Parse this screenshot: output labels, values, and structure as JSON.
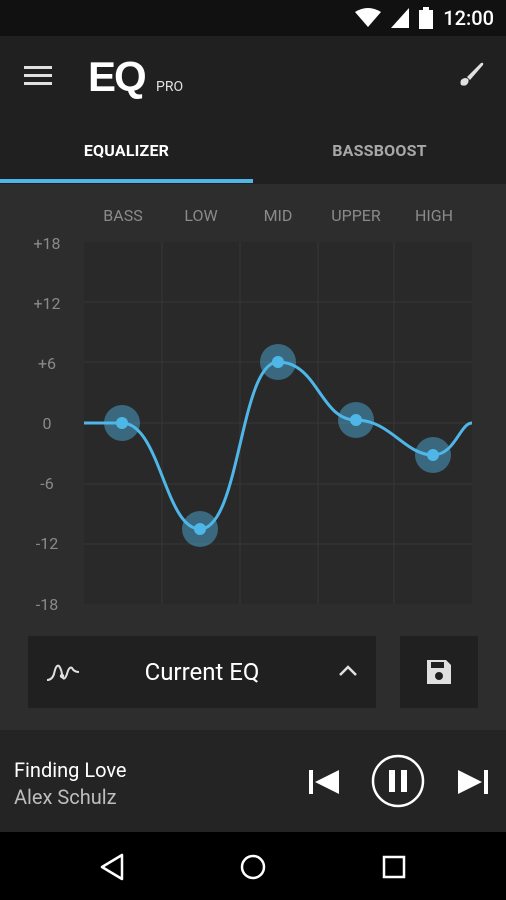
{
  "status": {
    "time": "12:00"
  },
  "app": {
    "logo": "EQ",
    "logo_sub": "PRO"
  },
  "tabs": [
    {
      "label": "EQUALIZER",
      "active": true
    },
    {
      "label": "BASSBOOST",
      "active": false
    }
  ],
  "bands": [
    "BASS",
    "LOW",
    "MID",
    "UPPER",
    "HIGH"
  ],
  "y_labels": [
    "+18",
    "+12",
    "+6",
    "0",
    "-6",
    "-12",
    "-18"
  ],
  "preset": {
    "label": "Current EQ"
  },
  "player": {
    "song": "Finding Love",
    "artist": "Alex Schulz"
  },
  "colors": {
    "accent": "#4fb7e8"
  }
}
